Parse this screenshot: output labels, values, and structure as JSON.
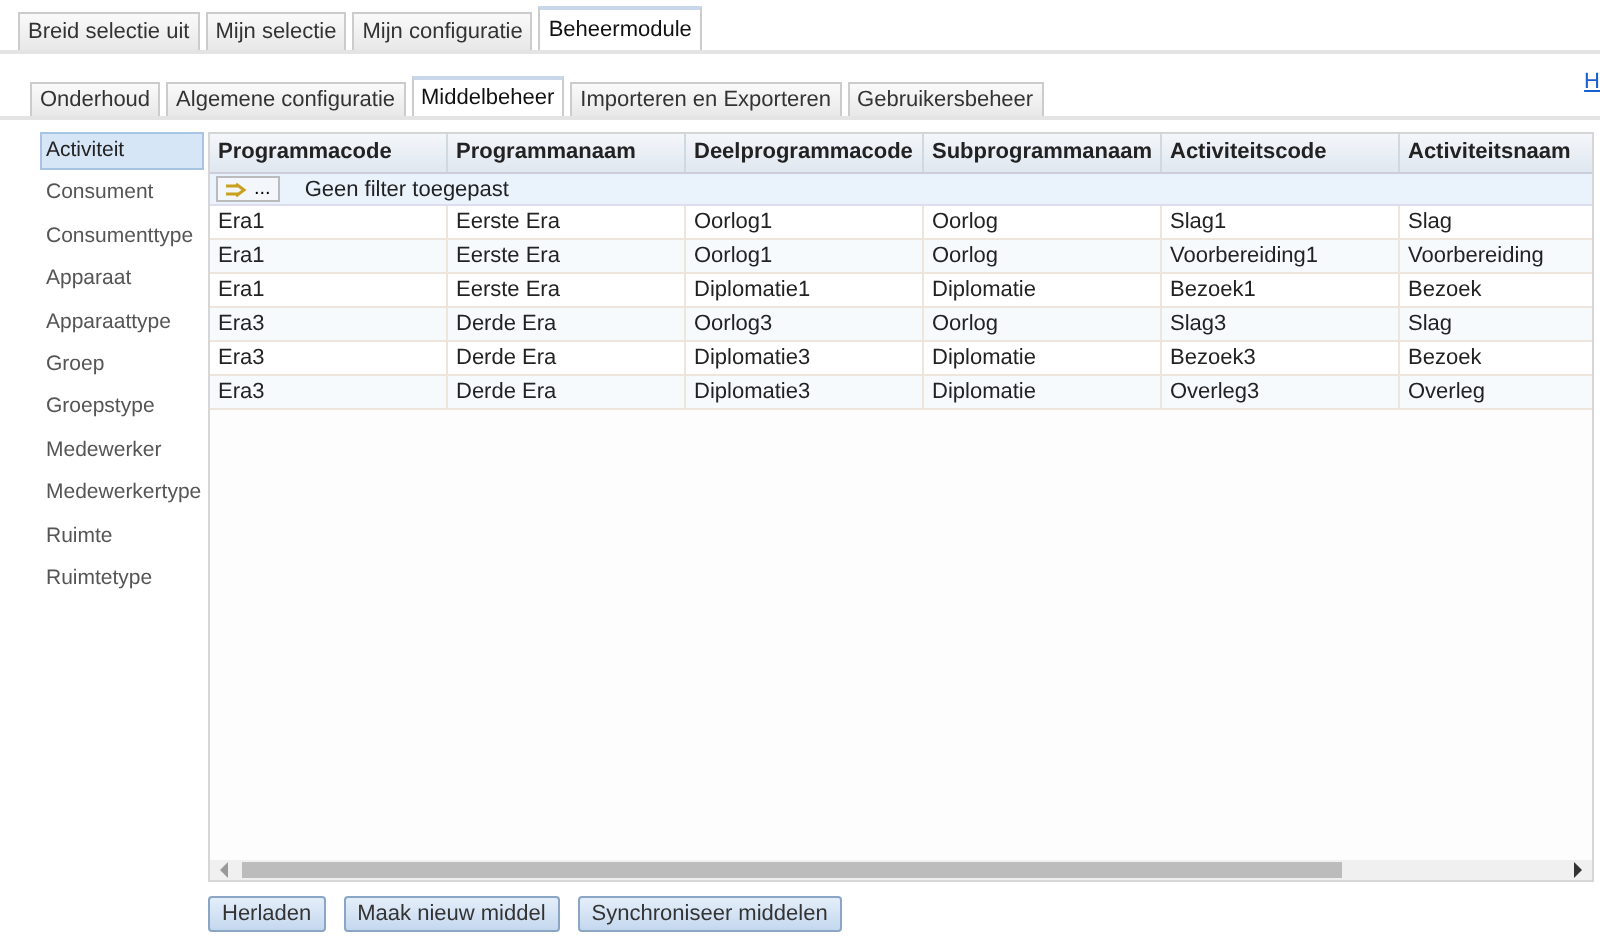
{
  "main_tabs": [
    {
      "label": "Breid selectie uit",
      "selected": false
    },
    {
      "label": "Mijn selectie",
      "selected": false
    },
    {
      "label": "Mijn configuratie",
      "selected": false
    },
    {
      "label": "Beheermodule",
      "selected": true
    }
  ],
  "help_link": "H",
  "sub_tabs": [
    {
      "label": "Onderhoud",
      "selected": false
    },
    {
      "label": "Algemene configuratie",
      "selected": false
    },
    {
      "label": "Middelbeheer",
      "selected": true
    },
    {
      "label": "Importeren en Exporteren",
      "selected": false
    },
    {
      "label": "Gebruikersbeheer",
      "selected": false
    }
  ],
  "sidebar": {
    "items": [
      {
        "label": "Activiteit",
        "selected": true
      },
      {
        "label": "Consument",
        "selected": false
      },
      {
        "label": "Consumenttype",
        "selected": false
      },
      {
        "label": "Apparaat",
        "selected": false
      },
      {
        "label": "Apparaattype",
        "selected": false
      },
      {
        "label": "Groep",
        "selected": false
      },
      {
        "label": "Groepstype",
        "selected": false
      },
      {
        "label": "Medewerker",
        "selected": false
      },
      {
        "label": "Medewerkertype",
        "selected": false
      },
      {
        "label": "Ruimte",
        "selected": false
      },
      {
        "label": "Ruimtetype",
        "selected": false
      }
    ]
  },
  "table": {
    "columns": [
      "Programmacode",
      "Programmanaam",
      "Deelprogrammacode",
      "Subprogrammanaam",
      "Activiteitscode",
      "Activiteitsnaam"
    ],
    "filter": {
      "button": "...",
      "text": "Geen filter toegepast"
    },
    "rows": [
      [
        "Era1",
        "Eerste Era",
        "Oorlog1",
        "Oorlog",
        "Slag1",
        "Slag"
      ],
      [
        "Era1",
        "Eerste Era",
        "Oorlog1",
        "Oorlog",
        "Voorbereiding1",
        "Voorbereiding"
      ],
      [
        "Era1",
        "Eerste Era",
        "Diplomatie1",
        "Diplomatie",
        "Bezoek1",
        "Bezoek"
      ],
      [
        "Era3",
        "Derde Era",
        "Oorlog3",
        "Oorlog",
        "Slag3",
        "Slag"
      ],
      [
        "Era3",
        "Derde Era",
        "Diplomatie3",
        "Diplomatie",
        "Bezoek3",
        "Bezoek"
      ],
      [
        "Era3",
        "Derde Era",
        "Diplomatie3",
        "Diplomatie",
        "Overleg3",
        "Overleg"
      ]
    ]
  },
  "buttons": [
    "Herladen",
    "Maak nieuw middel",
    "Synchroniseer middelen"
  ]
}
